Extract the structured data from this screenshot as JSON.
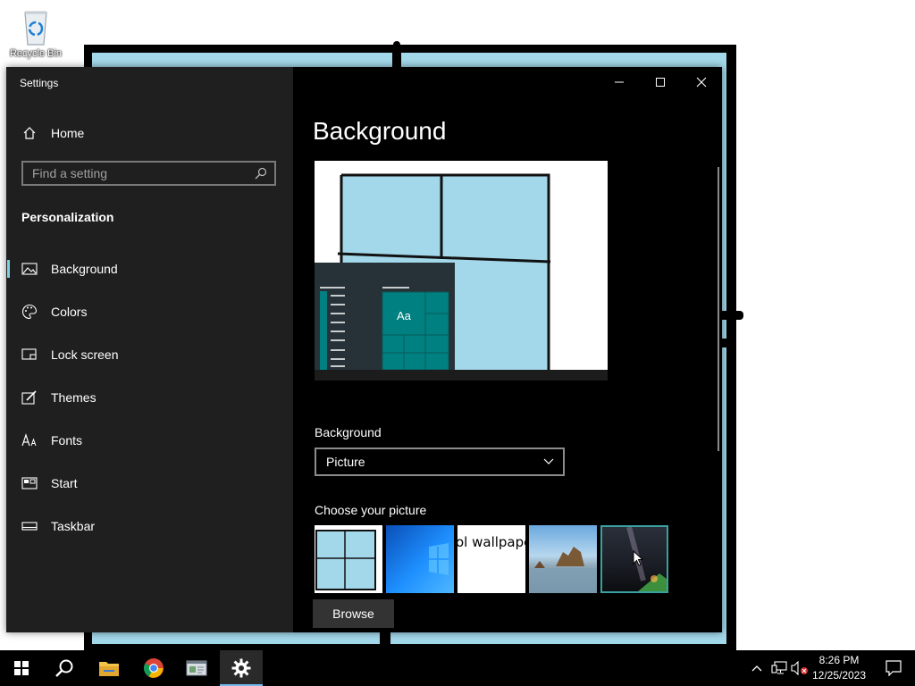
{
  "desktop": {
    "recycle_bin_label": "Recycle Bin",
    "wallpaper_color": "#a3d8ea"
  },
  "window": {
    "title": "Settings",
    "controls": [
      "minimize-icon",
      "maximize-icon",
      "close-icon"
    ]
  },
  "sidebar": {
    "home_label": "Home",
    "search_placeholder": "Find a setting",
    "section_title": "Personalization",
    "items": [
      {
        "label": "Background",
        "icon": "picture-icon",
        "active": true
      },
      {
        "label": "Colors",
        "icon": "palette-icon",
        "active": false
      },
      {
        "label": "Lock screen",
        "icon": "lock-screen-icon",
        "active": false
      },
      {
        "label": "Themes",
        "icon": "themes-brush-icon",
        "active": false
      },
      {
        "label": "Fonts",
        "icon": "fonts-icon",
        "active": false
      },
      {
        "label": "Start",
        "icon": "start-grid-icon",
        "active": false
      },
      {
        "label": "Taskbar",
        "icon": "taskbar-icon",
        "active": false
      }
    ]
  },
  "main": {
    "title": "Background",
    "preview_tile_text": "Aa",
    "background_label": "Background",
    "background_dropdown_value": "Picture",
    "choose_picture_label": "Choose your picture",
    "thumbnail_text_3": "ol wallpaper",
    "browse_label": "Browse",
    "accent_color": "#008080"
  },
  "taskbar": {
    "apps": [
      "windows-start-icon",
      "search-icon",
      "file-explorer-icon",
      "chrome-icon",
      "app-window-icon",
      "settings-gear-icon"
    ],
    "time": "8:26 PM",
    "date": "12/25/2023"
  }
}
